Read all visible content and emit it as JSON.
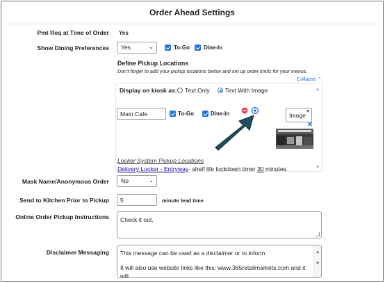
{
  "page": {
    "title": "Order Ahead Settings"
  },
  "pmt_req": {
    "label": "Pmt Req at Time of Order",
    "value": "Yes"
  },
  "dining_prefs": {
    "label": "Show Dining Preferences",
    "select_value": "Yes",
    "to_go_label": "To-Go",
    "dine_in_label": "Dine-In"
  },
  "pickup": {
    "heading": "Define Pickup Locations",
    "hint": "Don't forget to add your pickup locations below and set up order limits for your menus.",
    "collapse_label": "Collapse",
    "kiosk_label": "Display on kiosk as:",
    "text_only_label": "Text Only",
    "text_with_image_label": "Text With Image",
    "location_name": "Main Cafe",
    "loc_to_go_label": "To-Go",
    "loc_dine_in_label": "Dine-In",
    "image_button_label": "Image",
    "locker_heading": "Locker System Pickup Locations",
    "locker_link": "Delivery Locker - Entryway",
    "locker_text_pre": "- shelf life lockdown timer ",
    "locker_minutes": "30",
    "locker_text_post": " minutes"
  },
  "mask_name": {
    "label": "Mask Name/Anonymous Order",
    "select_value": "No"
  },
  "send_kitchen": {
    "label": "Send to Kitchen Prior to Pickup",
    "value": "5",
    "suffix": "minute lead time"
  },
  "instructions": {
    "label": "Online Order Pickup Instructions",
    "value": "Check it out."
  },
  "disclaimer": {
    "label": "Disclaimer Messaging",
    "line1": "This message can be used as a disclaimer or to inform.",
    "line2": "It will also use website links like this: www.365retailmarkets.com and it will"
  },
  "colors": {
    "accent": "#1a73e8",
    "arrow": "#1f4e63",
    "remove": "#e0475b",
    "link": "#1a0dab"
  }
}
